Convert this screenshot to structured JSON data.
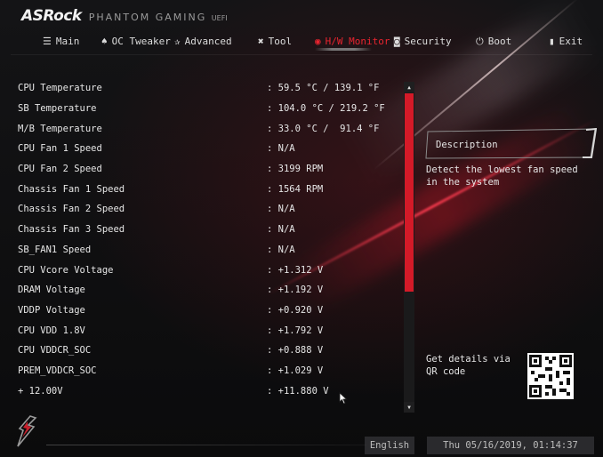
{
  "brand": {
    "logo": "ASRock",
    "subtitle": "PHANTOM GAMING",
    "uefi": "UEFI"
  },
  "tabs": [
    {
      "label": "Main",
      "icon": "list-icon"
    },
    {
      "label": "OC Tweaker",
      "icon": "flame-icon"
    },
    {
      "label": "Advanced",
      "icon": "star-icon"
    },
    {
      "label": "Tool",
      "icon": "tool-icon"
    },
    {
      "label": "H/W Monitor",
      "icon": "monitor-icon",
      "active": true
    },
    {
      "label": "Security",
      "icon": "shield-icon"
    },
    {
      "label": "Boot",
      "icon": "power-icon"
    },
    {
      "label": "Exit",
      "icon": "exit-icon"
    }
  ],
  "items": [
    {
      "label": "CPU Temperature",
      "value": ": 59.5 °C / 139.1 °F"
    },
    {
      "label": "SB Temperature",
      "value": ": 104.0 °C / 219.2 °F"
    },
    {
      "label": "M/B Temperature",
      "value": ": 33.0 °C /  91.4 °F"
    },
    {
      "label": "CPU Fan 1 Speed",
      "value": ": N/A"
    },
    {
      "label": "CPU Fan 2 Speed",
      "value": ": 3199 RPM"
    },
    {
      "label": "Chassis Fan 1 Speed",
      "value": ": 1564 RPM"
    },
    {
      "label": "Chassis Fan 2 Speed",
      "value": ": N/A"
    },
    {
      "label": "Chassis Fan 3 Speed",
      "value": ": N/A"
    },
    {
      "label": "SB_FAN1 Speed",
      "value": ": N/A"
    },
    {
      "label": "CPU Vcore Voltage",
      "value": ": +1.312 V"
    },
    {
      "label": "DRAM Voltage",
      "value": ": +1.192 V"
    },
    {
      "label": "VDDP Voltage",
      "value": ": +0.920 V"
    },
    {
      "label": "CPU VDD 1.8V",
      "value": ": +1.792 V"
    },
    {
      "label": "CPU VDDCR_SOC",
      "value": ": +0.888 V"
    },
    {
      "label": "PREM_VDDCR_SOC",
      "value": ": +1.029 V"
    },
    {
      "label": "+ 12.00V",
      "value": ": +11.880 V"
    }
  ],
  "description": {
    "title": "Description",
    "text": "Detect the lowest fan speed in the system"
  },
  "qr": {
    "text": "Get details via QR code"
  },
  "footer": {
    "language": "English",
    "datetime": "Thu 05/16/2019, 01:14:37"
  },
  "colors": {
    "accent": "#e8242f",
    "scroll_thumb": "#d41a28"
  }
}
